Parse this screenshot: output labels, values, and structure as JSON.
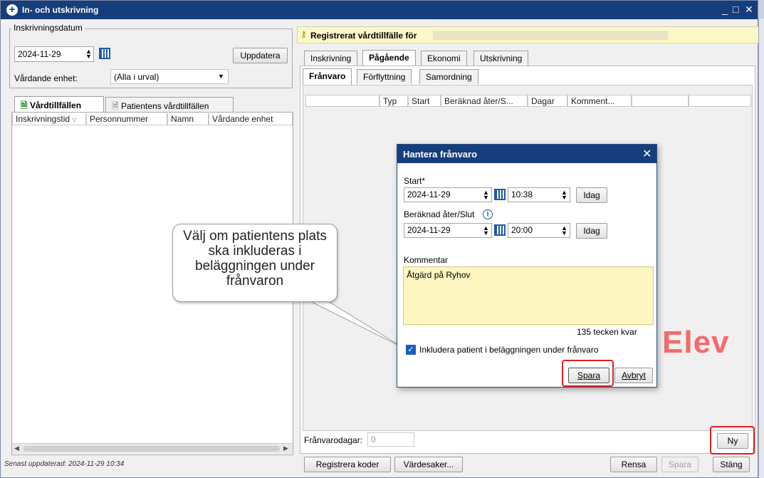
{
  "window": {
    "title": "In- och utskrivning",
    "controls": [
      "_",
      "□",
      "✕"
    ]
  },
  "left": {
    "legend": "Inskrivningsdatum",
    "date": "2024-11-29",
    "update_button": "Uppdatera",
    "unit_label": "Vårdande enhet:",
    "unit_value": "(Alla i urval)",
    "tabs": [
      "Vårdtillfällen",
      "Patientens vårdtillfällen"
    ],
    "columns": [
      "Inskrivningstid",
      "Personnummer",
      "Namn",
      "Vårdande enhet"
    ],
    "footer": "Senast uppdaterad: 2024-11-29 10:34"
  },
  "right": {
    "header": "Registrerat vårdtillfälle för",
    "tabs": [
      "Inskrivning",
      "Pågående",
      "Ekonomi",
      "Utskrivning"
    ],
    "subtabs": [
      "Frånvaro",
      "Förflyttning",
      "Samordning"
    ],
    "columns": [
      "Typ",
      "Start",
      "Beräknad åter/S...",
      "Dagar",
      "Komment..."
    ],
    "absence_days_label": "Frånvarodagar:",
    "absence_days_value": "0",
    "new_button": "Ny",
    "watermark": "Elev"
  },
  "dialog": {
    "title": "Hantera frånvaro",
    "start_label": "Start*",
    "start_date": "2024-11-29",
    "start_time": "10:38",
    "today1": "Idag",
    "end_label": "Beräknad åter/Slut",
    "end_date": "2024-11-29",
    "end_time": "20:00",
    "today2": "Idag",
    "comment_label": "Kommentar",
    "comment_value": "Åtgärd på Ryhov",
    "chars_left": "135 tecken kvar",
    "include_label": "Inkludera patient i beläggningen under frånvaro",
    "save": "Spara",
    "cancel": "Avbryt"
  },
  "callout": {
    "text": "Välj om patientens plats ska inkluderas i beläggningen under frånvaron"
  },
  "bottom": {
    "register_codes": "Registrera koder",
    "valuables": "Värdesaker...",
    "clear": "Rensa",
    "save": "Spara",
    "close": "Stäng"
  }
}
